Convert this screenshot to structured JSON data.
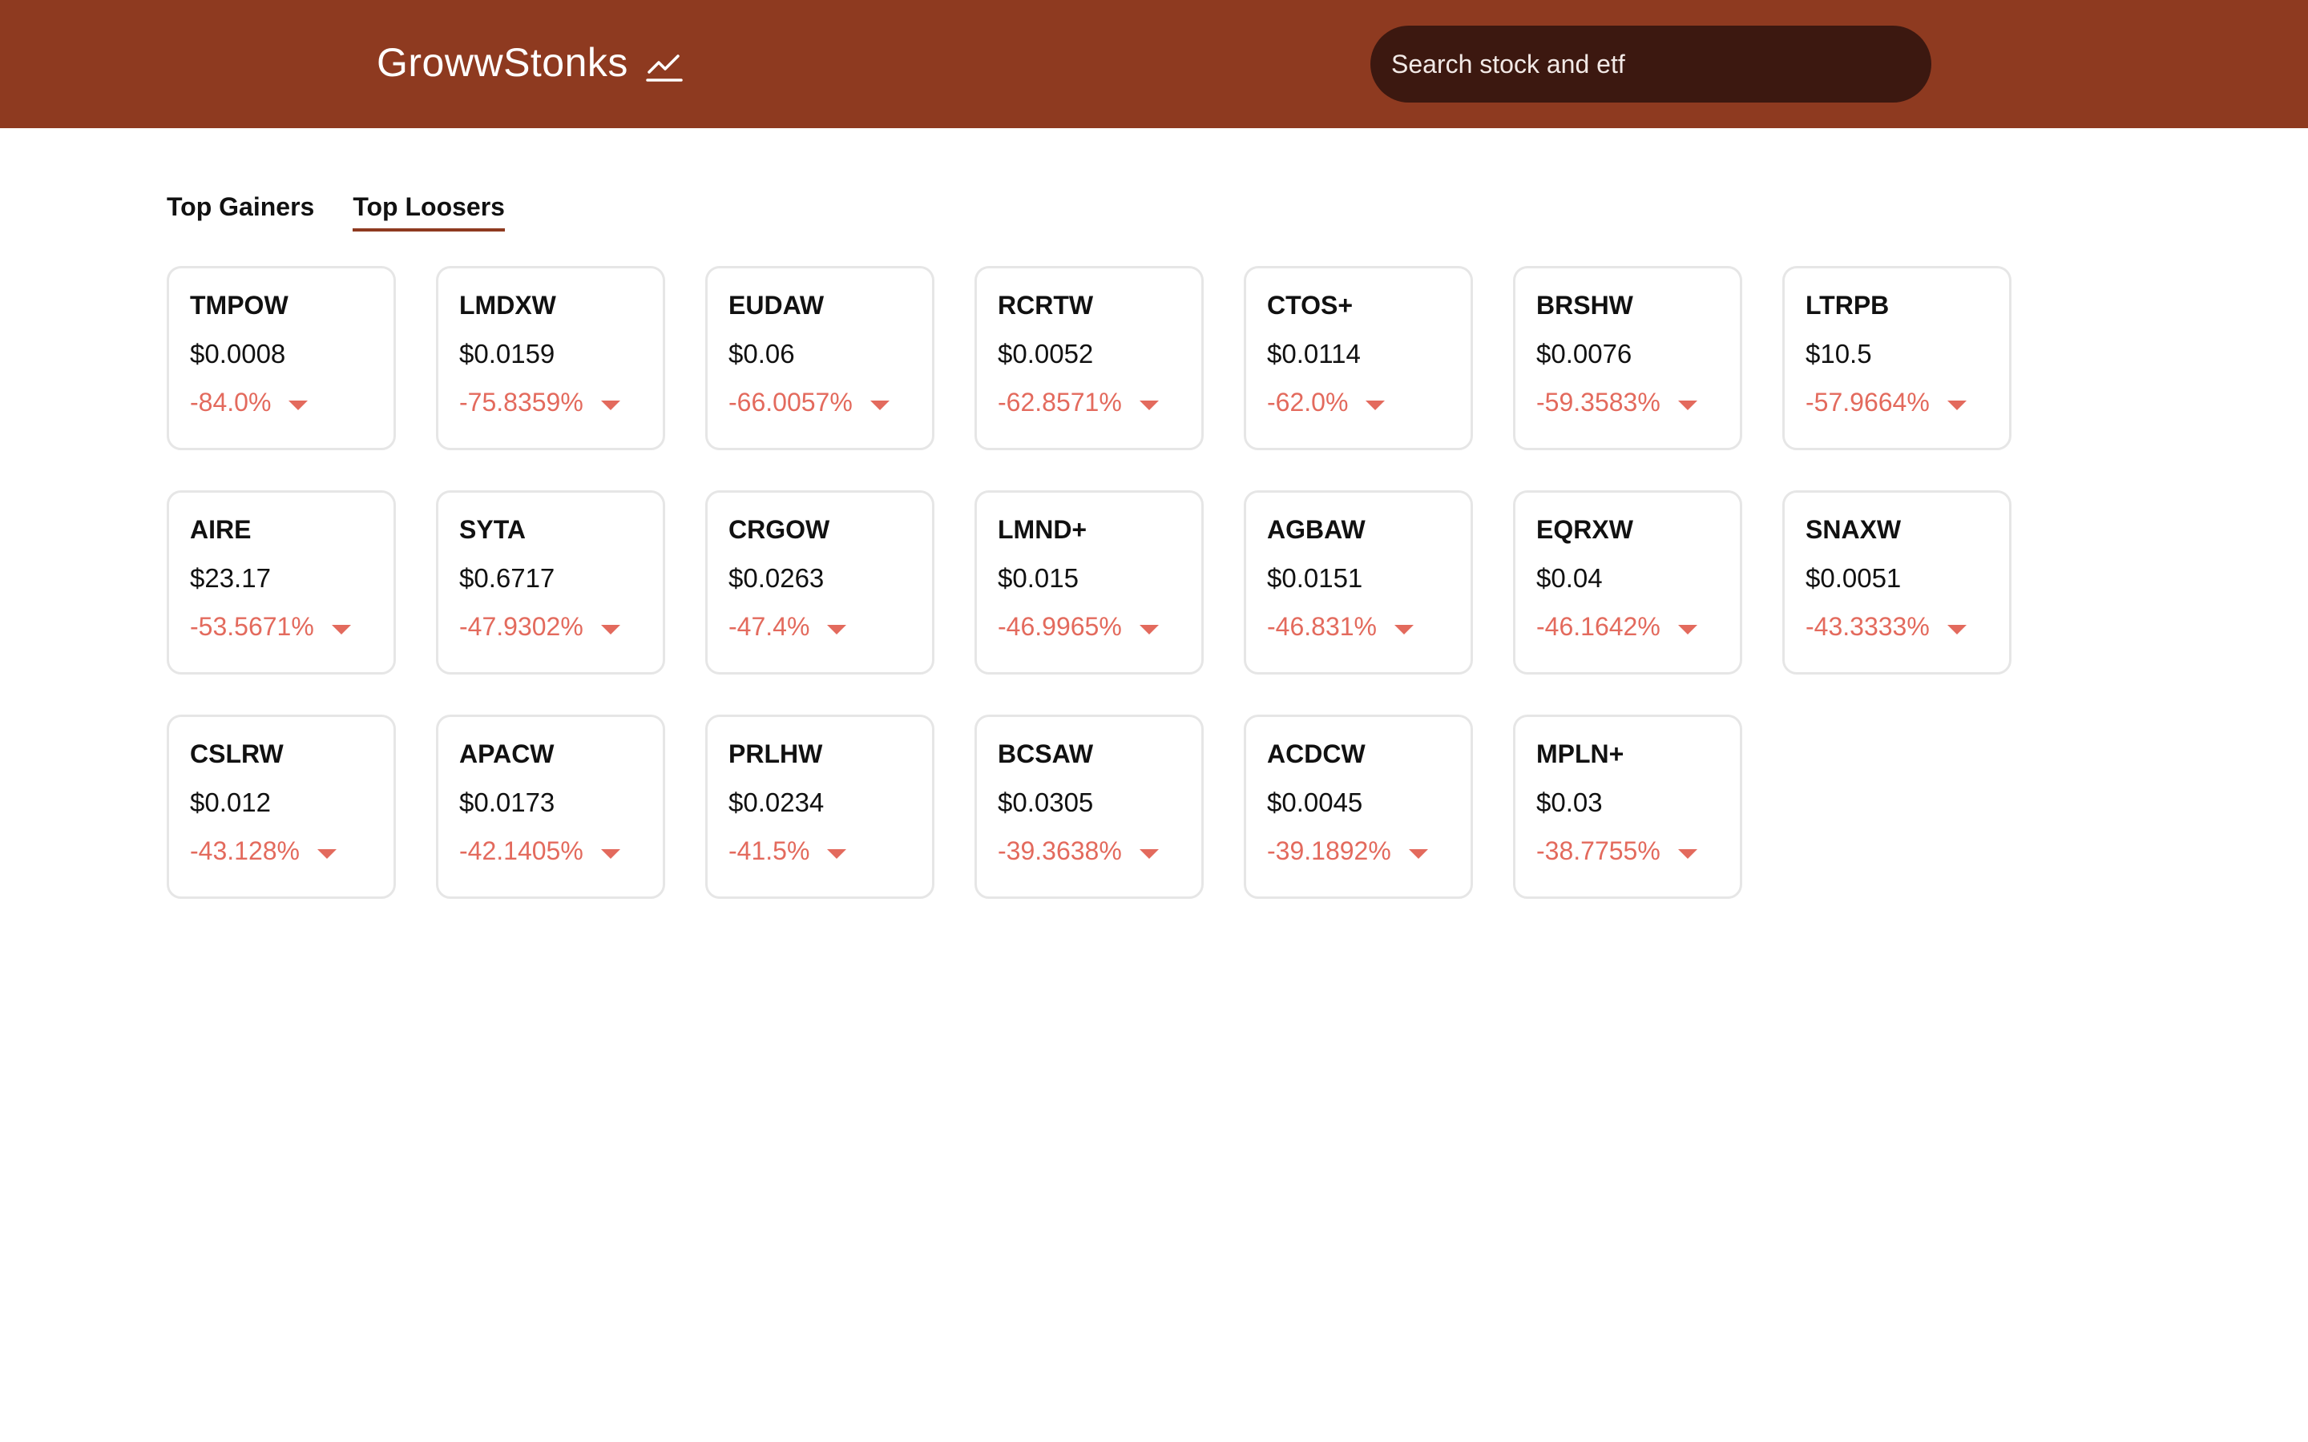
{
  "header": {
    "brand": "GrowwStonks",
    "brand_icon": "trending-chart-icon",
    "search_placeholder": "Search stock and etf"
  },
  "tabs": [
    {
      "label": "Top Gainers",
      "active": false
    },
    {
      "label": "Top Loosers",
      "active": true
    }
  ],
  "colors": {
    "header_bg": "#8e3a20",
    "search_bg": "#3c1810",
    "loss": "#e36a5d",
    "tab_underline": "#8e3a20"
  },
  "stocks": [
    {
      "ticker": "TMPOW",
      "price": "$0.0008",
      "change": "-84.0%"
    },
    {
      "ticker": "LMDXW",
      "price": "$0.0159",
      "change": "-75.8359%"
    },
    {
      "ticker": "EUDAW",
      "price": "$0.06",
      "change": "-66.0057%"
    },
    {
      "ticker": "RCRTW",
      "price": "$0.0052",
      "change": "-62.8571%"
    },
    {
      "ticker": "CTOS+",
      "price": "$0.0114",
      "change": "-62.0%"
    },
    {
      "ticker": "BRSHW",
      "price": "$0.0076",
      "change": "-59.3583%"
    },
    {
      "ticker": "LTRPB",
      "price": "$10.5",
      "change": "-57.9664%"
    },
    {
      "ticker": "AIRE",
      "price": "$23.17",
      "change": "-53.5671%"
    },
    {
      "ticker": "SYTA",
      "price": "$0.6717",
      "change": "-47.9302%"
    },
    {
      "ticker": "CRGOW",
      "price": "$0.0263",
      "change": "-47.4%"
    },
    {
      "ticker": "LMND+",
      "price": "$0.015",
      "change": "-46.9965%"
    },
    {
      "ticker": "AGBAW",
      "price": "$0.0151",
      "change": "-46.831%"
    },
    {
      "ticker": "EQRXW",
      "price": "$0.04",
      "change": "-46.1642%"
    },
    {
      "ticker": "SNAXW",
      "price": "$0.0051",
      "change": "-43.3333%"
    },
    {
      "ticker": "CSLRW",
      "price": "$0.012",
      "change": "-43.128%"
    },
    {
      "ticker": "APACW",
      "price": "$0.0173",
      "change": "-42.1405%"
    },
    {
      "ticker": "PRLHW",
      "price": "$0.0234",
      "change": "-41.5%"
    },
    {
      "ticker": "BCSAW",
      "price": "$0.0305",
      "change": "-39.3638%"
    },
    {
      "ticker": "ACDCW",
      "price": "$0.0045",
      "change": "-39.1892%"
    },
    {
      "ticker": "MPLN+",
      "price": "$0.03",
      "change": "-38.7755%"
    }
  ]
}
